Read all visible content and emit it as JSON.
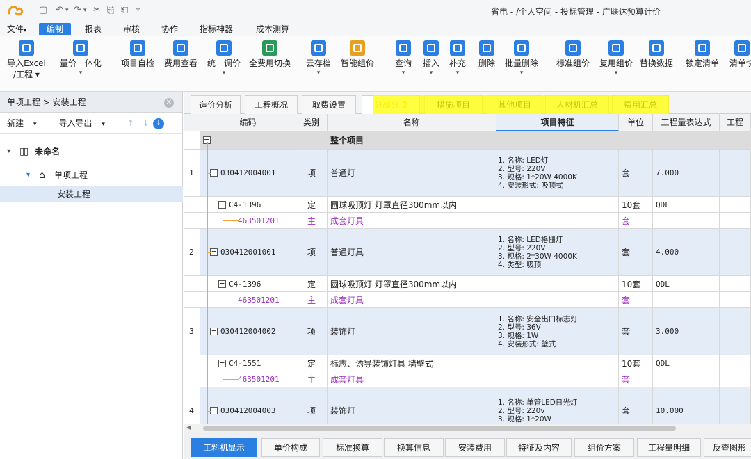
{
  "window": {
    "title": "省电 - /个人空间 - 投标管理 - 广联达预算计价",
    "quick_access": [
      "▢",
      "↶",
      "▾",
      "↷",
      "▾",
      "✂",
      "⎘",
      "⎗",
      "▿"
    ]
  },
  "menu": [
    "文件",
    "编制",
    "报表",
    "审核",
    "协作",
    "指标神器",
    "成本测算"
  ],
  "menu_active": 1,
  "menu_file_arrow": "▾",
  "ribbon": [
    {
      "label": "导入Excel",
      "sub": "/工程 ▾",
      "color": "#2a7fe0"
    },
    {
      "label": "量价一体化",
      "sub": "▾",
      "color": "#2a7fe0"
    },
    {
      "label": "项目自检",
      "sub": "",
      "color": "#2a7fe0"
    },
    {
      "label": "费用查看",
      "sub": "",
      "color": "#2a7fe0"
    },
    {
      "label": "统一调价",
      "sub": "▾",
      "color": "#2a7fe0"
    },
    {
      "label": "全费用切换",
      "sub": "",
      "color": "#2a9a5a"
    },
    {
      "label": "云存档",
      "sub": "▾",
      "color": "#2a7fe0"
    },
    {
      "label": "智能组价",
      "sub": "",
      "color": "#e8a020"
    },
    {
      "label": "查询",
      "sub": "▾",
      "color": "#2a7fe0"
    },
    {
      "label": "插入",
      "sub": "▾",
      "color": "#2a7fe0"
    },
    {
      "label": "补充",
      "sub": "▾",
      "color": "#2a7fe0"
    },
    {
      "label": "删除",
      "sub": "",
      "color": "#2a7fe0"
    },
    {
      "label": "批量删除",
      "sub": "▾",
      "color": "#2a7fe0"
    },
    {
      "label": "标准组价",
      "sub": "",
      "color": "#2a7fe0"
    },
    {
      "label": "复用组价",
      "sub": "▾",
      "color": "#2a7fe0"
    },
    {
      "label": "替换数据",
      "sub": "",
      "color": "#2a7fe0"
    },
    {
      "label": "锁定清单",
      "sub": "",
      "color": "#2a7fe0"
    },
    {
      "label": "清单快",
      "sub": "",
      "color": "#2a7fe0"
    }
  ],
  "left_panel": {
    "breadcrumb": "单项工程 > 安装工程",
    "close": "✕",
    "new_label": "新建",
    "import_label": "导入导出",
    "arrow": "▾",
    "up": "↑",
    "down": "↓",
    "collapse": "↓",
    "tree": [
      {
        "label": "未命名",
        "level": 0,
        "expander": "▾",
        "icon": "▥"
      },
      {
        "label": "单项工程",
        "level": 1,
        "expander": "▾",
        "icon": "⌂"
      },
      {
        "label": "安装工程",
        "level": 2,
        "expander": "",
        "icon": ""
      }
    ]
  },
  "tabs": [
    "造价分析",
    "工程概况",
    "取费设置",
    "分部分项",
    "措施项目",
    "其他项目",
    "人材机汇总",
    "费用汇总"
  ],
  "tabs_active": 3,
  "columns": [
    "",
    "编码",
    "类别",
    "名称",
    "项目特征",
    "单位",
    "工程量表达式",
    "工程"
  ],
  "total_row": {
    "label": "整个项目",
    "toggle": "−"
  },
  "rows": [
    {
      "type": "item",
      "num": "1",
      "code": "030412004001",
      "cat": "项",
      "name": "普通灯",
      "feat": [
        "1. 名称: LED灯",
        "2. 型号: 220V",
        "3. 规格: 1*20W 4000K",
        "4. 安装形式: 吸顶式"
      ],
      "unit": "套",
      "expr": "7.000"
    },
    {
      "type": "quota",
      "code": "C4-1396",
      "cat": "定",
      "name": "圆球吸顶灯 灯罩直径300mm以内",
      "unit": "10套",
      "expr": "QDL"
    },
    {
      "type": "main",
      "code": "463501201",
      "cat": "主",
      "name": "成套灯具",
      "unit": "套",
      "expr": ""
    },
    {
      "type": "item",
      "num": "2",
      "code": "030412001001",
      "cat": "项",
      "name": "普通灯具",
      "feat": [
        "1. 名称: LED格栅灯",
        "2. 型号: 220V",
        "3. 规格: 2*30W 4000K",
        "4. 类型: 吸顶"
      ],
      "unit": "套",
      "expr": "4.000"
    },
    {
      "type": "quota",
      "code": "C4-1396",
      "cat": "定",
      "name": "圆球吸顶灯 灯罩直径300mm以内",
      "unit": "10套",
      "expr": "QDL"
    },
    {
      "type": "main",
      "code": "463501201",
      "cat": "主",
      "name": "成套灯具",
      "unit": "套",
      "expr": ""
    },
    {
      "type": "item",
      "num": "3",
      "code": "030412004002",
      "cat": "项",
      "name": "装饰灯",
      "feat": [
        "1. 名称: 安全出口标志灯",
        "2. 型号: 36V",
        "3. 规格: 1W",
        "4. 安装形式: 壁式"
      ],
      "unit": "套",
      "expr": "3.000"
    },
    {
      "type": "quota",
      "code": "C4-1551",
      "cat": "定",
      "name": "标志、诱导装饰灯具 墙壁式",
      "unit": "10套",
      "expr": "QDL"
    },
    {
      "type": "main",
      "code": "463501201",
      "cat": "主",
      "name": "成套灯具",
      "unit": "套",
      "expr": ""
    },
    {
      "type": "item",
      "num": "4",
      "code": "030412004003",
      "cat": "项",
      "name": "装饰灯",
      "feat": [
        "1. 名称: 单管LED日光灯",
        "2. 型号: 220v",
        "3. 规格: 1*20W"
      ],
      "unit": "套",
      "expr": "10.000"
    }
  ],
  "bottom_tabs": [
    "工料机显示",
    "单价构成",
    "标准换算",
    "换算信息",
    "安装费用",
    "特征及内容",
    "组价方案",
    "工程量明细",
    "反查图形"
  ],
  "bottom_active": 0,
  "scroll_left": "◀"
}
